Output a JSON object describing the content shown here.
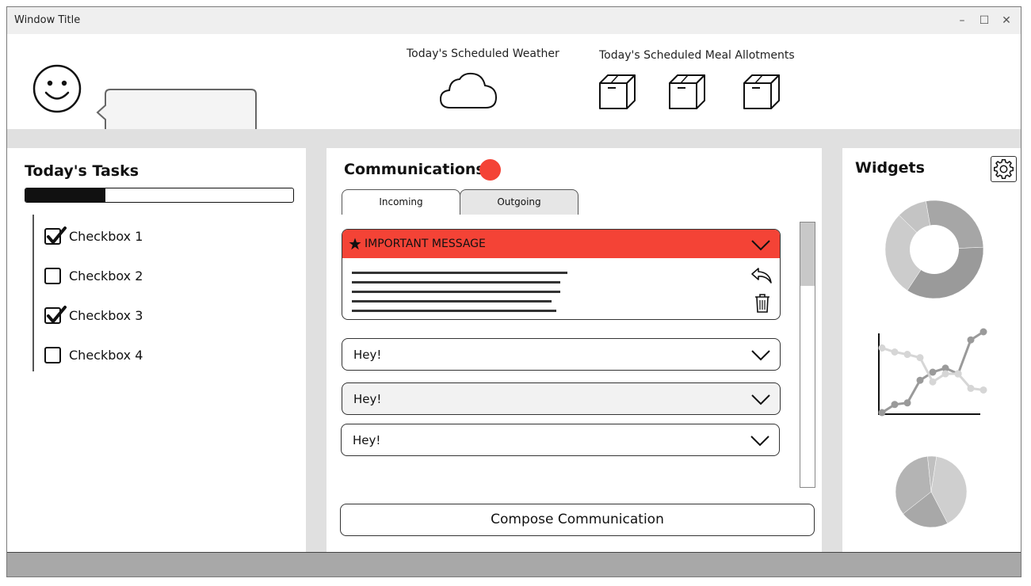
{
  "window": {
    "title": "Window Title",
    "minimize": "–",
    "maximize": "☐",
    "close": "✕"
  },
  "header": {
    "weather_label": "Today's Scheduled Weather",
    "weather_icon": "cloud-icon",
    "meals_label": "Today's Scheduled Meal Allotments",
    "meal_icons": [
      "package-icon",
      "package-icon",
      "package-icon"
    ],
    "speech_bubble_text": ""
  },
  "tasks": {
    "title": "Today's Tasks",
    "progress": 0.3,
    "items": [
      {
        "label": "Checkbox 1",
        "checked": true
      },
      {
        "label": "Checkbox 2",
        "checked": false
      },
      {
        "label": "Checkbox 3",
        "checked": true
      },
      {
        "label": "Checkbox 4",
        "checked": false
      }
    ]
  },
  "communications": {
    "title": "Communications",
    "notification_color": "#f44336",
    "tabs": [
      {
        "label": "Incoming",
        "active": true
      },
      {
        "label": "Outgoing",
        "active": false
      }
    ],
    "important_message": {
      "title": "IMPORTANT MESSAGE",
      "color": "#f44336"
    },
    "messages": [
      {
        "text": "Hey!"
      },
      {
        "text": "Hey!"
      },
      {
        "text": "Hey!"
      }
    ],
    "compose_label": "Compose Communication"
  },
  "widgets": {
    "title": "Widgets",
    "settings_icon": "gear-icon",
    "chart_data": [
      {
        "type": "pie",
        "values": [
          10,
          27,
          35,
          28
        ]
      },
      {
        "type": "line",
        "series": [
          {
            "values": [
              0,
              1,
              1.2,
              4,
              5,
              5.5,
              4.8,
              9,
              10
            ]
          },
          {
            "values": [
              8,
              7.5,
              7.2,
              6.8,
              3.8,
              4.8,
              4.8,
              3,
              2.8
            ]
          }
        ]
      },
      {
        "type": "pie",
        "values": [
          40,
          22,
          34,
          4
        ]
      }
    ]
  }
}
